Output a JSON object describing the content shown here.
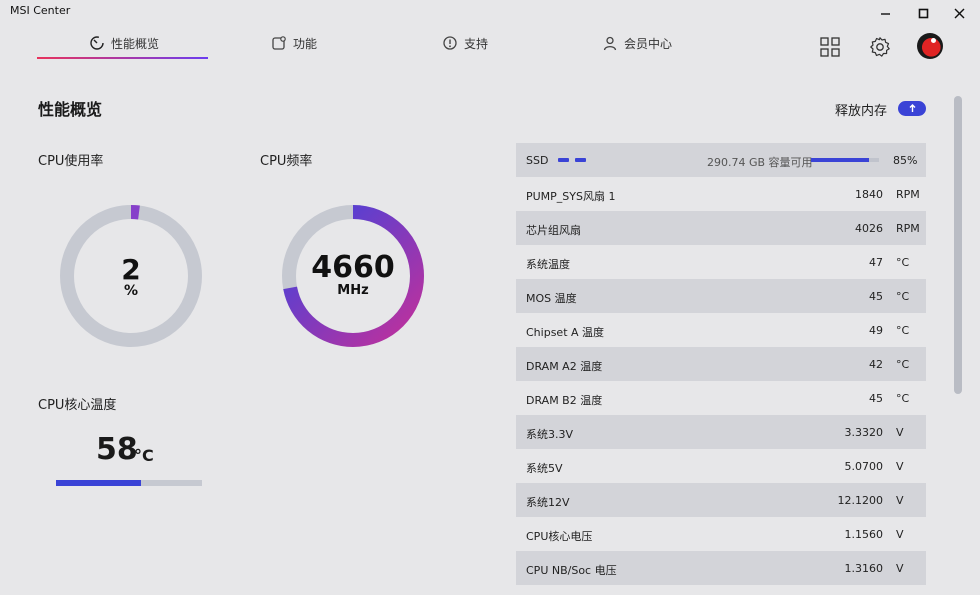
{
  "window": {
    "title": "MSI Center"
  },
  "nav": {
    "tabs": [
      {
        "label": "性能概览",
        "icon": "gauge-icon",
        "active": true
      },
      {
        "label": "功能",
        "icon": "feature-icon"
      },
      {
        "label": "支持",
        "icon": "support-icon"
      },
      {
        "label": "会员中心",
        "icon": "member-icon"
      }
    ],
    "accent_start": "#e8335c",
    "accent_end": "#6b3df0"
  },
  "page": {
    "title": "性能概览",
    "release_memory_label": "释放内存"
  },
  "cpu_usage": {
    "label": "CPU使用率",
    "value": "2",
    "unit": "%",
    "percent": 2
  },
  "cpu_freq": {
    "label": "CPU频率",
    "value": "4660",
    "unit": "MHz",
    "percent": 72
  },
  "cpu_temp": {
    "label": "CPU核心温度",
    "value": "58",
    "unit": "°C",
    "percent": 58
  },
  "ssd": {
    "name": "SSD",
    "capacity": "290.74 GB 容量可用",
    "percent_label": "85%",
    "percent": 85
  },
  "sensors": [
    {
      "name": "PUMP_SYS风扇 1",
      "value": "1840",
      "unit": "RPM"
    },
    {
      "name": "芯片组风扇",
      "value": "4026",
      "unit": "RPM"
    },
    {
      "name": "系统温度",
      "value": "47",
      "unit": "°C"
    },
    {
      "name": "MOS 温度",
      "value": "45",
      "unit": "°C"
    },
    {
      "name": "Chipset A 温度",
      "value": "49",
      "unit": "°C"
    },
    {
      "name": "DRAM A2 温度",
      "value": "42",
      "unit": "°C"
    },
    {
      "name": "DRAM B2 温度",
      "value": "45",
      "unit": "°C"
    },
    {
      "name": "系统3.3V",
      "value": "3.3320",
      "unit": "V"
    },
    {
      "name": "系统5V",
      "value": "5.0700",
      "unit": "V"
    },
    {
      "name": "系统12V",
      "value": "12.1200",
      "unit": "V"
    },
    {
      "name": "CPU核心电压",
      "value": "1.1560",
      "unit": "V"
    },
    {
      "name": "CPU NB/Soc 电压",
      "value": "1.3160",
      "unit": "V"
    }
  ]
}
